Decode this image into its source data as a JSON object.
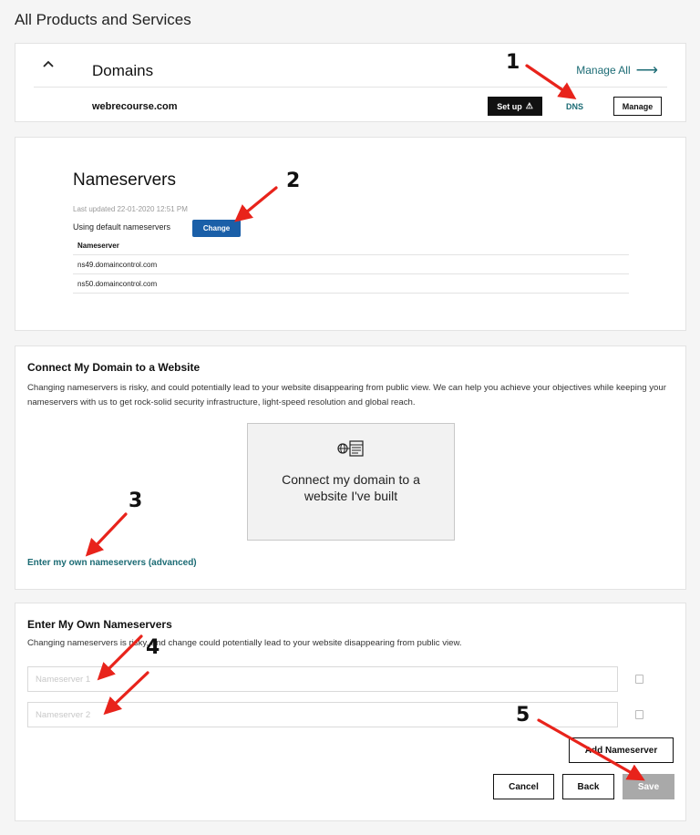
{
  "page": {
    "title": "All Products and Services"
  },
  "domains_card": {
    "title": "Domains",
    "manage_all_label": "Manage All",
    "domain_name": "webrecourse.com",
    "setup_label": "Set up",
    "dns_label": "DNS",
    "manage_label": "Manage"
  },
  "nameservers_card": {
    "title": "Nameservers",
    "last_updated": "Last updated 22-01-2020 12:51 PM",
    "using_default": "Using default nameservers",
    "change_label": "Change",
    "table_header": "Nameserver",
    "rows": [
      "ns49.domaincontrol.com",
      "ns50.domaincontrol.com"
    ]
  },
  "connect_card": {
    "title": "Connect My Domain to a Website",
    "description": "Changing nameservers is risky, and could potentially lead to your website disappearing from public view. We can help you achieve your objectives while keeping your nameservers with us to get rock-solid security infrastructure, light-speed resolution and global reach.",
    "box_text": "Connect my domain to a website I've built",
    "box_icon": "website-globe-icon",
    "advanced_link": "Enter my own nameservers (advanced)"
  },
  "own_ns_card": {
    "title": "Enter My Own Nameservers",
    "description": "Changing nameservers is risky, and change could potentially lead to your website disappearing from public view.",
    "input1_placeholder": "Nameserver 1",
    "input2_placeholder": "Nameserver 2",
    "add_label": "Add Nameserver",
    "cancel_label": "Cancel",
    "back_label": "Back",
    "save_label": "Save"
  },
  "annotations": {
    "step1": "1",
    "step2": "2",
    "step3": "3",
    "step4": "4",
    "step5": "5",
    "arrow_color": "#e8231b"
  },
  "colors": {
    "link_teal": "#1b6b74",
    "change_blue": "#1a5fa8",
    "save_disabled": "#a9a9a9"
  }
}
